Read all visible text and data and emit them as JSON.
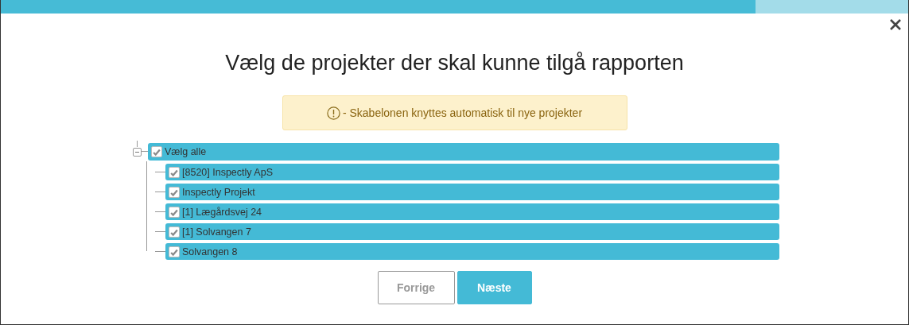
{
  "progress": {
    "level": 0.832
  },
  "title": "Vælg de projekter der skal kunne tilgå rapporten",
  "alert": {
    "text": "- Skabelonen knyttes automatisk til nye projekter"
  },
  "tree": {
    "label": "Vælg alle",
    "checked": true,
    "expanded": true,
    "children": [
      {
        "label": "[8520] Inspectly ApS",
        "checked": true
      },
      {
        "label": "Inspectly Projekt",
        "checked": true
      },
      {
        "label": "[1] Lægårdsvej 24",
        "checked": true
      },
      {
        "label": "[1] Solvangen 7",
        "checked": true
      },
      {
        "label": "Solvangen 8",
        "checked": true
      }
    ]
  },
  "buttons": [
    {
      "label": "Forrige",
      "kind": "secondary"
    },
    {
      "label": "Næste",
      "kind": "primary"
    }
  ]
}
